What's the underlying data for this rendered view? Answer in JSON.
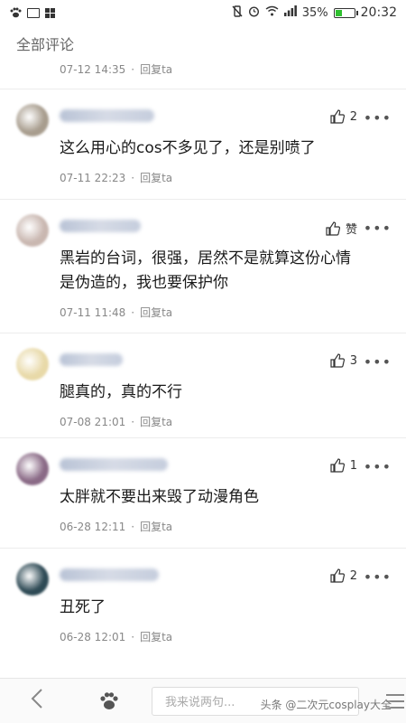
{
  "status_bar": {
    "battery": "35%",
    "battery_level": 0.35,
    "time": "20:32",
    "battery_color": "#2fbf2f"
  },
  "header": {
    "title": "全部评论"
  },
  "top_partial": {
    "time": "07-12 14:35",
    "reply": "回复ta"
  },
  "comments": [
    {
      "likes": "2",
      "text": "这么用心的cos不多见了，还是别喷了",
      "time": "07-11 22:23",
      "reply": "回复ta",
      "avatar_color": "#a89d8e"
    },
    {
      "likes": "赞",
      "text": "黑岩的台词，很强，居然不是就算这份心情是伪造的，我也要保护你",
      "time": "07-11 11:48",
      "reply": "回复ta",
      "avatar_color": "#c9b7b0"
    },
    {
      "likes": "3",
      "text": "腿真的，真的不行",
      "time": "07-08 21:01",
      "reply": "回复ta",
      "avatar_color": "#e8d9a8"
    },
    {
      "likes": "1",
      "text": "太胖就不要出来毁了动漫角色",
      "time": "06-28 12:11",
      "reply": "回复ta",
      "avatar_color": "#8a6a86"
    },
    {
      "likes": "2",
      "text": "丑死了",
      "time": "06-28 12:01",
      "reply": "回复ta",
      "avatar_color": "#2e4a55"
    }
  ],
  "bottom_bar": {
    "input_placeholder": "我来说两句...",
    "watermark": "头条 @二次元cosplay大全"
  }
}
